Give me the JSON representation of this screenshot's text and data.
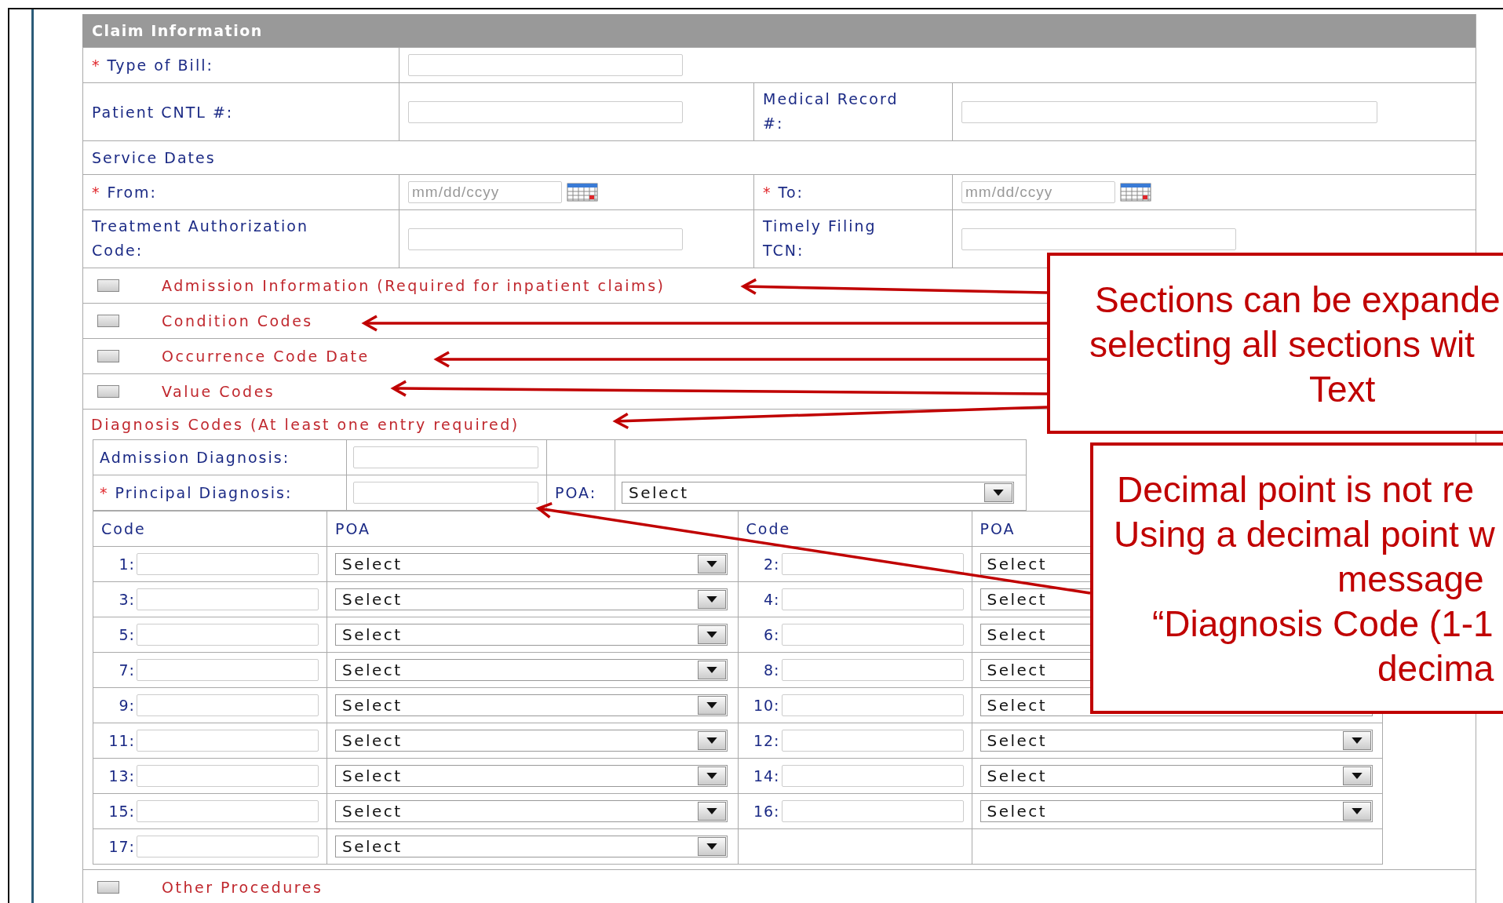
{
  "panel": {
    "title": "Claim Information"
  },
  "type_of_bill": {
    "required_mark": "*",
    "label": "Type of Bill:"
  },
  "patient_cntl": {
    "label": "Patient CNTL #:"
  },
  "medical_record": {
    "label": "Medical Record #:"
  },
  "service_dates": {
    "heading": "Service Dates",
    "from": {
      "required_mark": "*",
      "label": "From:",
      "placeholder": "mm/dd/ccyy"
    },
    "to": {
      "required_mark": "*",
      "label": "To:",
      "placeholder": "mm/dd/ccyy"
    }
  },
  "treatment_authorization": {
    "label": "Treatment Authorization Code:"
  },
  "timely_filing": {
    "label": "Timely Filing TCN:"
  },
  "sections": [
    {
      "label": "Admission Information (Required for inpatient claims)",
      "checked": false
    },
    {
      "label": "Condition Codes",
      "checked": false
    },
    {
      "label": "Occurrence Code Date",
      "checked": false
    },
    {
      "label": "Value Codes",
      "checked": false
    }
  ],
  "diagnosis": {
    "heading": "Diagnosis Codes (At least one entry required)",
    "admission": {
      "label": "Admission Diagnosis:"
    },
    "principal": {
      "required_mark": "*",
      "label": "Principal Diagnosis:",
      "poa_label": "POA:",
      "poa_value": "Select"
    },
    "columns": [
      "Code",
      "POA",
      "Code",
      "POA"
    ],
    "codes": [
      {
        "number": "1:",
        "poa": "Select"
      },
      {
        "number": "2:",
        "poa": "Select"
      },
      {
        "number": "3:",
        "poa": "Select"
      },
      {
        "number": "4:",
        "poa": "Select"
      },
      {
        "number": "5:",
        "poa": "Select"
      },
      {
        "number": "6:",
        "poa": "Select"
      },
      {
        "number": "7:",
        "poa": "Select"
      },
      {
        "number": "8:",
        "poa": "Select"
      },
      {
        "number": "9:",
        "poa": "Select"
      },
      {
        "number": "10:",
        "poa": "Select"
      },
      {
        "number": "11:",
        "poa": "Select"
      },
      {
        "number": "12:",
        "poa": "Select"
      },
      {
        "number": "13:",
        "poa": "Select"
      },
      {
        "number": "14:",
        "poa": "Select"
      },
      {
        "number": "15:",
        "poa": "Select"
      },
      {
        "number": "16:",
        "poa": "Select"
      },
      {
        "number": "17:",
        "poa": "Select"
      }
    ]
  },
  "other_sections": [
    {
      "label": "Other Procedures",
      "checked": false
    }
  ],
  "callouts": [
    {
      "lines": [
        "Sections can be expande",
        "selecting all sections wit",
        "Text"
      ]
    },
    {
      "lines": [
        "Decimal point is not re",
        "Using a decimal point w",
        "message",
        "“Diagnosis Code (1-1",
        "decima"
      ]
    }
  ]
}
